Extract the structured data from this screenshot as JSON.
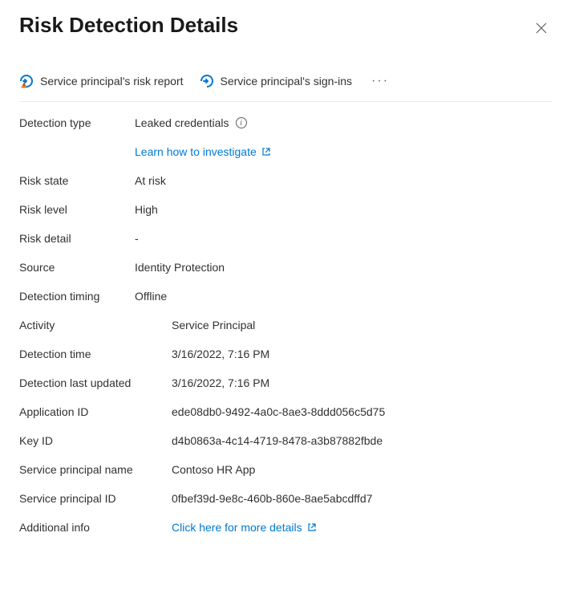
{
  "header": {
    "title": "Risk Detection Details"
  },
  "toolbar": {
    "risk_report": "Service principal's risk report",
    "sign_ins": "Service principal's sign-ins"
  },
  "details1": {
    "detection_type": {
      "label": "Detection type",
      "value": "Leaked credentials"
    },
    "investigate_link": "Learn how to investigate",
    "risk_state": {
      "label": "Risk state",
      "value": "At risk"
    },
    "risk_level": {
      "label": "Risk level",
      "value": "High"
    },
    "risk_detail": {
      "label": "Risk detail",
      "value": "-"
    },
    "source": {
      "label": "Source",
      "value": "Identity Protection"
    },
    "detection_timing": {
      "label": "Detection timing",
      "value": "Offline"
    }
  },
  "details2": {
    "activity": {
      "label": "Activity",
      "value": "Service Principal"
    },
    "detection_time": {
      "label": "Detection time",
      "value": "3/16/2022, 7:16 PM"
    },
    "detection_last_updated": {
      "label": "Detection last updated",
      "value": "3/16/2022, 7:16 PM"
    },
    "application_id": {
      "label": "Application ID",
      "value": "ede08db0-9492-4a0c-8ae3-8ddd056c5d75"
    },
    "key_id": {
      "label": "Key ID",
      "value": "d4b0863a-4c14-4719-8478-a3b87882fbde"
    },
    "sp_name": {
      "label": "Service principal name",
      "value": "Contoso HR App"
    },
    "sp_id": {
      "label": "Service principal ID",
      "value": "0fbef39d-9e8c-460b-860e-8ae5abcdffd7"
    },
    "additional_info": {
      "label": "Additional info",
      "link": "Click here for more details"
    }
  }
}
